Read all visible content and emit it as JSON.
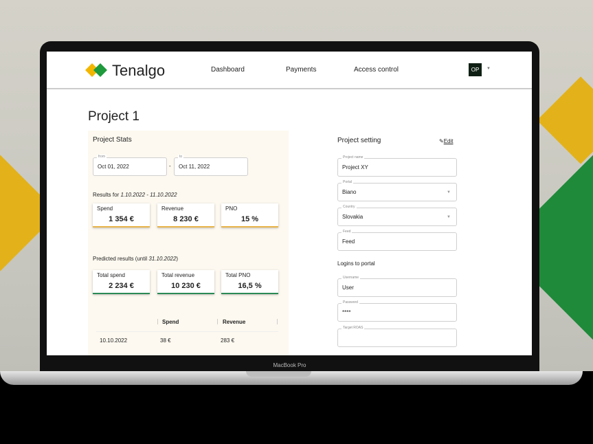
{
  "device_label": "MacBook Pro",
  "header": {
    "brand": "Tenalgo",
    "nav": [
      "Dashboard",
      "Payments",
      "Access control"
    ],
    "avatar": "OP"
  },
  "page_title": "Project 1",
  "stats": {
    "title": "Project Stats",
    "from_label": "from",
    "from_value": "Oct 01, 2022",
    "to_label": "to",
    "to_value": "Oct 11, 2022",
    "dash": "-",
    "results_prefix": "Results for ",
    "results_range": "1.10.2022 - 11.10.2022",
    "cards": [
      {
        "label": "Spend",
        "value": "1 354 €"
      },
      {
        "label": "Revenue",
        "value": "8 230 €"
      },
      {
        "label": "PNO",
        "value": "15 %"
      }
    ],
    "predicted_prefix": "Predicted results (until ",
    "predicted_date": "31.10.2022",
    "predicted_suffix": ")",
    "predicted_cards": [
      {
        "label": "Total spend",
        "value": "2 234 €"
      },
      {
        "label": "Total revenue",
        "value": "10 230 €"
      },
      {
        "label": "Total PNO",
        "value": "16,5 %"
      }
    ],
    "table": {
      "headers": [
        "Spend",
        "Revenue"
      ],
      "rows": [
        {
          "date": "10.10.2022",
          "spend": "38 €",
          "revenue": "283 €"
        }
      ]
    }
  },
  "settings": {
    "title": "Project setting",
    "edit": "Edit",
    "fields": [
      {
        "label": "Project name",
        "value": "Project XY"
      },
      {
        "label": "Portal",
        "value": "Biano"
      },
      {
        "label": "Country",
        "value": "Slovakia"
      },
      {
        "label": "Feed",
        "value": "Feed"
      }
    ],
    "logins_title": "Logins to portal",
    "login_fields": [
      {
        "label": "Username",
        "value": "User"
      },
      {
        "label": "Password",
        "value": "****"
      },
      {
        "label": "Target ROAS",
        "value": ""
      }
    ]
  }
}
